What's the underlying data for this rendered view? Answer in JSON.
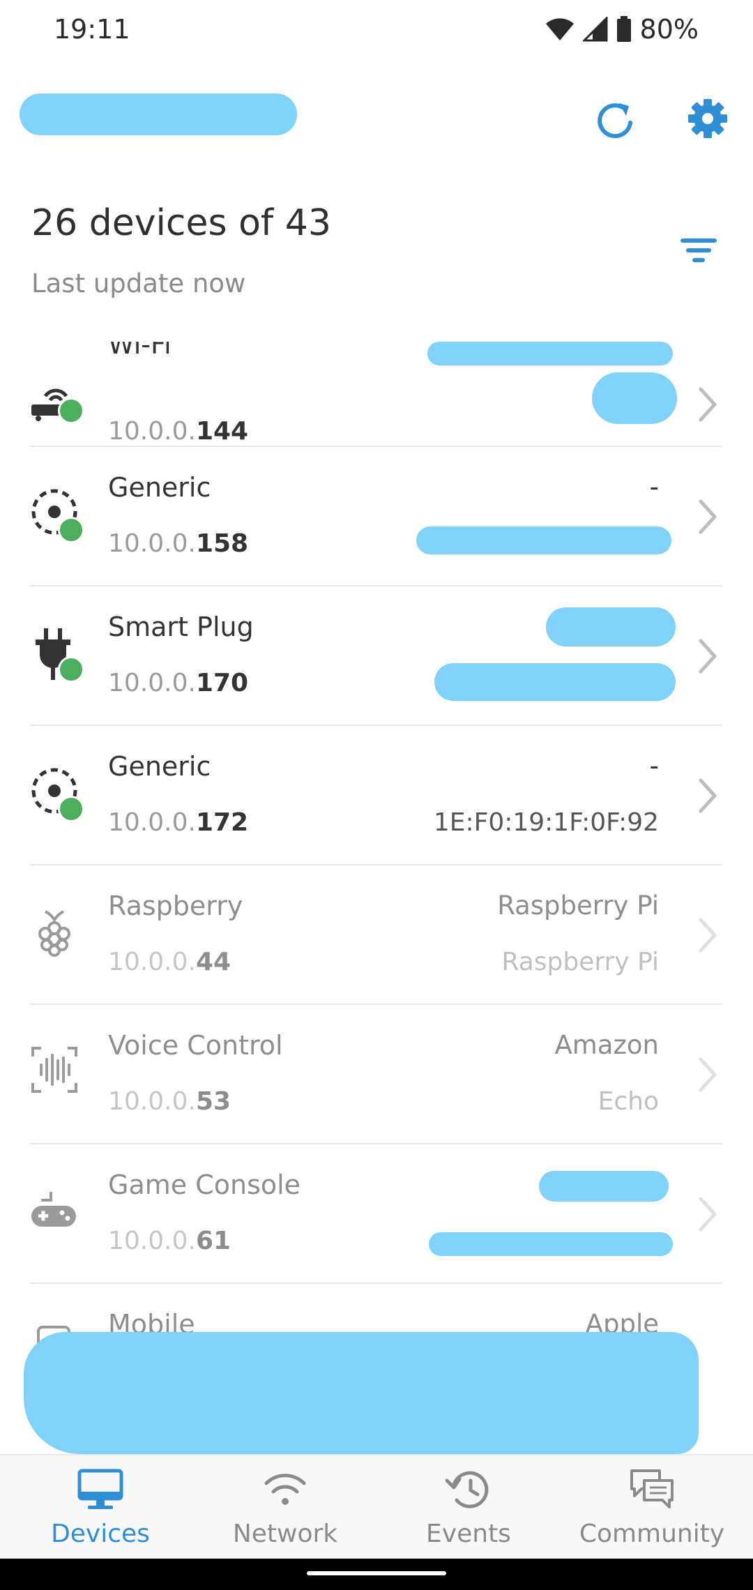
{
  "status_bar": {
    "time": "19:11",
    "battery": "80%"
  },
  "header": {
    "refresh_icon": "refresh-icon",
    "settings_icon": "gear-icon"
  },
  "summary": {
    "title": "26 devices of 43",
    "subtitle": "Last update now"
  },
  "devices": [
    {
      "name": "Wi-Fi",
      "ip_prefix": "10.0.0.",
      "ip_suffix": "144",
      "vendor": "",
      "model": "",
      "online": true,
      "icon": "router-icon"
    },
    {
      "name": "Generic",
      "ip_prefix": "10.0.0.",
      "ip_suffix": "158",
      "vendor": "-",
      "model": "",
      "online": true,
      "icon": "generic-device-icon"
    },
    {
      "name": "Smart Plug",
      "ip_prefix": "10.0.0.",
      "ip_suffix": "170",
      "vendor": "",
      "model": "",
      "online": true,
      "icon": "plug-icon"
    },
    {
      "name": "Generic",
      "ip_prefix": "10.0.0.",
      "ip_suffix": "172",
      "vendor": "-",
      "model": "1E:F0:19:1F:0F:92",
      "online": true,
      "icon": "generic-device-icon"
    },
    {
      "name": "Raspberry",
      "ip_prefix": "10.0.0.",
      "ip_suffix": "44",
      "vendor": "Raspberry Pi",
      "model": "Raspberry Pi",
      "online": false,
      "icon": "raspberry-icon"
    },
    {
      "name": "Voice Control",
      "ip_prefix": "10.0.0.",
      "ip_suffix": "53",
      "vendor": "Amazon",
      "model": "Echo",
      "online": false,
      "icon": "voice-control-icon"
    },
    {
      "name": "Game Console",
      "ip_prefix": "10.0.0.",
      "ip_suffix": "61",
      "vendor": "",
      "model": "",
      "online": false,
      "icon": "gamepad-icon"
    },
    {
      "name": "Mobile",
      "ip_prefix": "",
      "ip_suffix": "",
      "vendor": "Apple",
      "model": "",
      "online": false,
      "icon": "mobile-icon"
    }
  ],
  "bottom_nav": [
    {
      "label": "Devices",
      "icon": "monitor-icon",
      "active": true
    },
    {
      "label": "Network",
      "icon": "wifi-icon",
      "active": false
    },
    {
      "label": "Events",
      "icon": "history-icon",
      "active": false
    },
    {
      "label": "Community",
      "icon": "chat-icon",
      "active": false
    }
  ],
  "colors": {
    "accent": "#2f8fd6",
    "online": "#4caf5f",
    "redaction": "#80d2fb"
  }
}
